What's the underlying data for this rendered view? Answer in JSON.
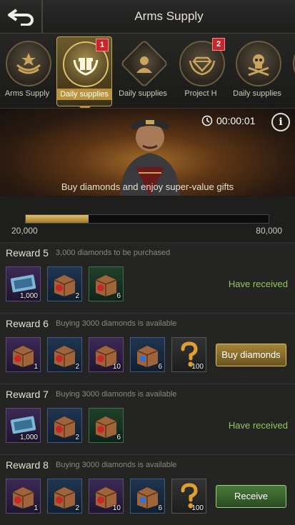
{
  "header": {
    "title": "Arms Supply"
  },
  "tabs": [
    {
      "label": "Arms Supply",
      "badge": ""
    },
    {
      "label": "Daily supplies",
      "badge": "1"
    },
    {
      "label": "Daily supplies",
      "badge": ""
    },
    {
      "label": "Project H",
      "badge": "2"
    },
    {
      "label": "Daily supplies",
      "badge": ""
    }
  ],
  "banner": {
    "timer": "00:00:01",
    "info": "i",
    "promo": "Buy diamonds and enjoy super-value gifts"
  },
  "progress": {
    "min": "20,000",
    "max": "80,000",
    "fraction": 0.26
  },
  "rewards": [
    {
      "title": "Reward 5",
      "desc": "3,000 diamonds to be purchased",
      "status": "Have received",
      "items": [
        {
          "count": "1,000"
        },
        {
          "count": "2"
        },
        {
          "count": "6"
        }
      ]
    },
    {
      "title": "Reward 6",
      "desc": "Buying 3000 diamonds is available",
      "button": "Buy diamonds",
      "items": [
        {
          "count": "1"
        },
        {
          "count": "2"
        },
        {
          "count": "10"
        },
        {
          "count": "6"
        },
        {
          "count": "100"
        }
      ]
    },
    {
      "title": "Reward 7",
      "desc": "Buying 3000 diamonds is available",
      "status": "Have received",
      "items": [
        {
          "count": "1,000"
        },
        {
          "count": "2"
        },
        {
          "count": "6"
        }
      ]
    },
    {
      "title": "Reward 8",
      "desc": "Buying 3000 diamonds is available",
      "button": "Receive",
      "items": [
        {
          "count": "1"
        },
        {
          "count": "2"
        },
        {
          "count": "10"
        },
        {
          "count": "6"
        },
        {
          "count": "100"
        }
      ]
    }
  ],
  "colors": {
    "accent_gold": "#b8923c",
    "received_green": "#8fc95e",
    "badge_red": "#c6262b"
  },
  "icons": [
    "back-arrow-icon",
    "clock-icon",
    "info-icon",
    "question-mark-icon",
    "supply-crate-icon",
    "ticket-icon"
  ]
}
